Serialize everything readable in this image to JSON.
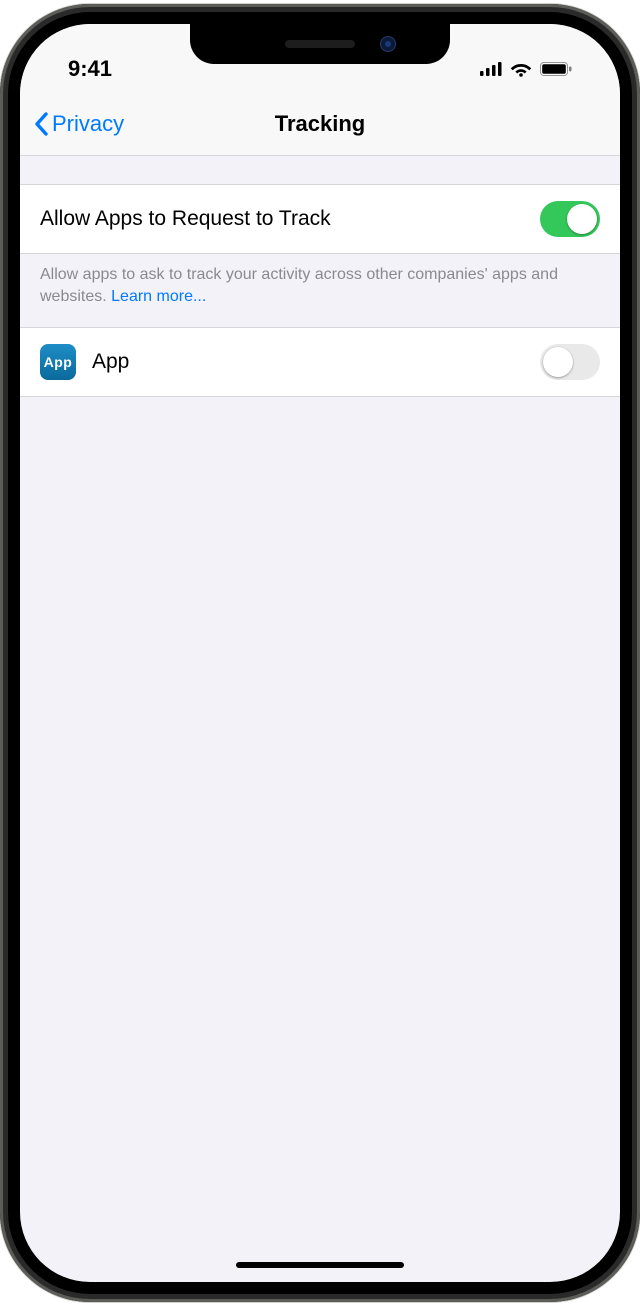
{
  "status": {
    "time": "9:41"
  },
  "nav": {
    "back_label": "Privacy",
    "title": "Tracking"
  },
  "settings": {
    "allow_tracking": {
      "label": "Allow Apps to Request to Track",
      "enabled": true
    },
    "footer_text": "Allow apps to ask to track your activity across other companies' apps and websites. ",
    "footer_link": "Learn more..."
  },
  "apps": [
    {
      "icon_text": "App",
      "name": "App",
      "enabled": false
    }
  ]
}
